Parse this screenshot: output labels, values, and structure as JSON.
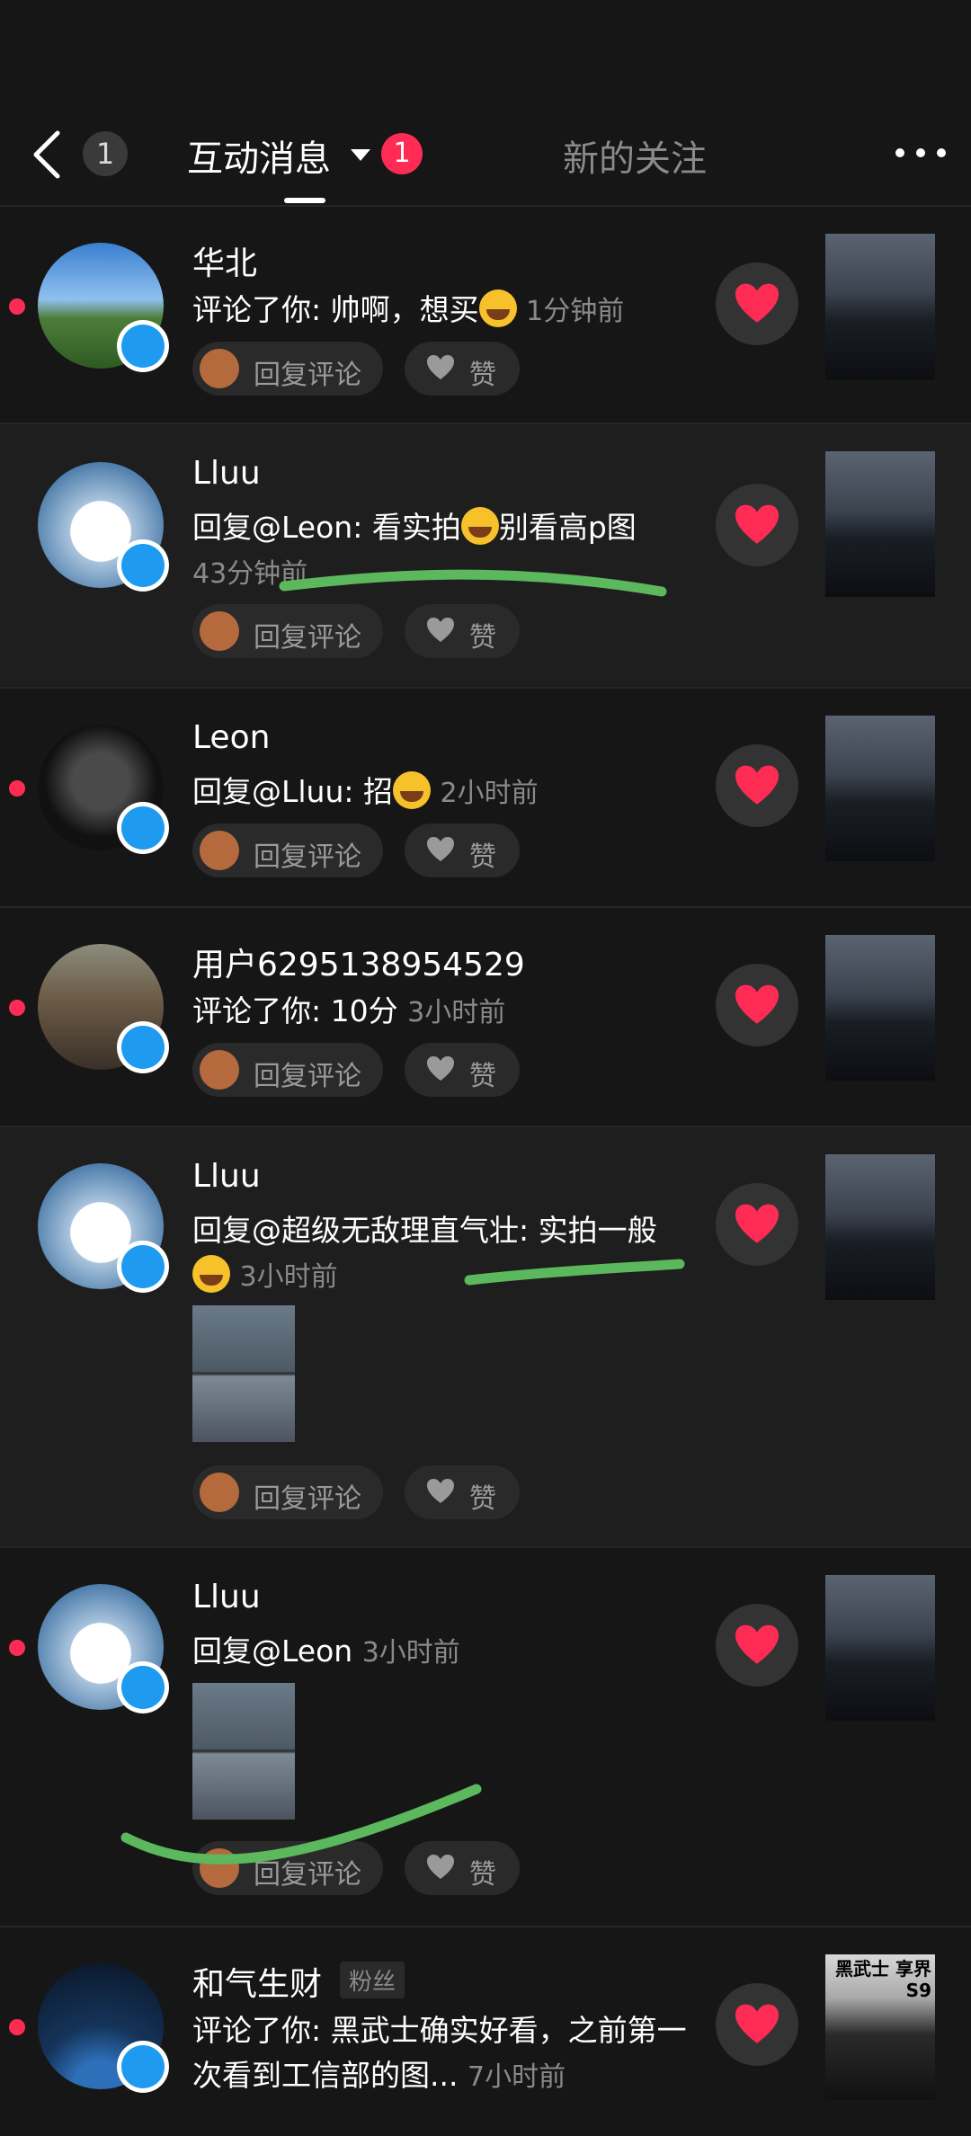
{
  "header": {
    "back_count": "1",
    "tab_active": "互动消息",
    "tab_badge": "1",
    "tab_second": "新的关注"
  },
  "actions": {
    "reply_label": "回复评论",
    "like_label": "赞"
  },
  "items": [
    {
      "name": "华北",
      "text": "评论了你: 帅啊，想买",
      "time": "1分钟前"
    },
    {
      "name": "Lluu",
      "text": "回复@Leon: 看实拍",
      "text_tail": "别看高p图",
      "time": "43分钟前"
    },
    {
      "name": "Leon",
      "text": "回复@Lluu: 招",
      "time": "2小时前"
    },
    {
      "name": "用户6295138954529",
      "text": "评论了你: 10分",
      "time": "3小时前"
    },
    {
      "name": "Lluu",
      "text": "回复@超级无敌理直气壮: 实拍一般",
      "time": "3小时前"
    },
    {
      "name": "Lluu",
      "text": "回复@Leon",
      "time": "3小时前"
    },
    {
      "name": "和气生财",
      "tag": "粉丝",
      "text": "评论了你: 黑武士确实好看，之前第一次看到工信部的图...",
      "time": "7小时前"
    }
  ],
  "thumb_caption": "黑武士 享界S9",
  "colors": {
    "accent": "#fe2c55",
    "message_badge": "#1e9bf0",
    "highlight_stroke": "#5cb85c"
  }
}
